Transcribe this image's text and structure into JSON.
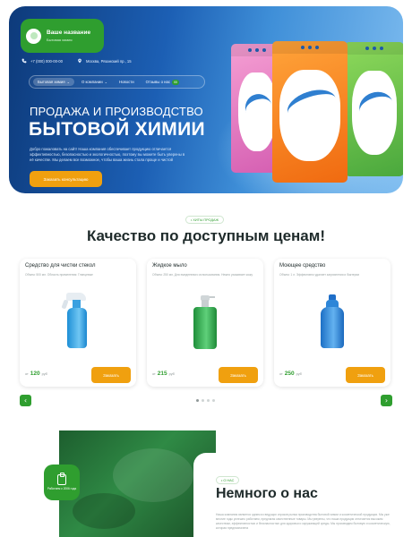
{
  "header": {
    "logo_title": "Ваше название",
    "logo_subtitle": "Бытовая химия",
    "phone": "+7 (000) 000-00-00",
    "address": "Москва, Рязанский пр., 15"
  },
  "nav": {
    "items": [
      {
        "label": "Бытовая химия",
        "active": true,
        "chevron": true
      },
      {
        "label": "О компании",
        "active": false,
        "chevron": true
      },
      {
        "label": "Новости",
        "active": false,
        "chevron": false
      },
      {
        "label": "Отзывы о нас",
        "active": false,
        "chevron": false,
        "badge": "00"
      }
    ]
  },
  "hero": {
    "line1": "ПРОДАЖА И ПРОИЗВОДСТВО",
    "line2": "БЫТОВОЙ ХИМИИ",
    "description": "Добро пожаловать на сайт! Наша компания обеспечивает продукцию отличается эффективностью, безопасностью и экологичностью, поэтому вы можете быть уверены в её качестве. Мы делаем все возможное, чтобы ваша жизнь стала проще и чистой",
    "button": "Заказать консультацию"
  },
  "products_section": {
    "tag": "• ХИТЫ ПРОДАЖ",
    "title": "Качество по доступным ценам!",
    "cards": [
      {
        "name": "Средство для чистки стекол",
        "desc": "Объем: 500 мл. Область применения: Глянцевые",
        "price_prefix": "от",
        "price": "120",
        "currency": "руб",
        "button": "Заказать"
      },
      {
        "name": "Жидкое мыло",
        "desc": "Объем: 250 мл. Для ежедневного использования. Нежно ухаживает кожу",
        "price_prefix": "от",
        "price": "215",
        "currency": "руб",
        "button": "Заказать"
      },
      {
        "name": "Моющее средство",
        "desc": "Объем: 1 л. Эффективно удаляет загрязнения и бактерии",
        "price_prefix": "от",
        "price": "250",
        "currency": "руб",
        "button": "Заказать"
      }
    ],
    "prev_arrow": "‹",
    "next_arrow": "›",
    "dots_total": 4,
    "dots_active": 0
  },
  "about": {
    "badge_text": "Работаем с 2006 года",
    "tag": "• О НАС",
    "title": "Немного о нас",
    "description": "Наша компания является одним из ведущих игроков рынка производства бытовой химии и косметической продукции. Мы уже многие годы успешно работаем, предлагая качественные товары. Мы уверены, что наша продукция отличается высоким качеством, эффективностью и безопасностью для здоровья и окружающей среды. Мы производим бытовую и косметическую, которая предназначена"
  },
  "colors": {
    "accent_green": "#2f9e2f",
    "accent_orange": "#f0a00f",
    "hero_blue": "#1c5fb4"
  },
  "icons": [
    "phone-icon",
    "location-icon",
    "chevron-down-icon",
    "chevron-left-icon",
    "chevron-right-icon",
    "bottle-icon"
  ]
}
